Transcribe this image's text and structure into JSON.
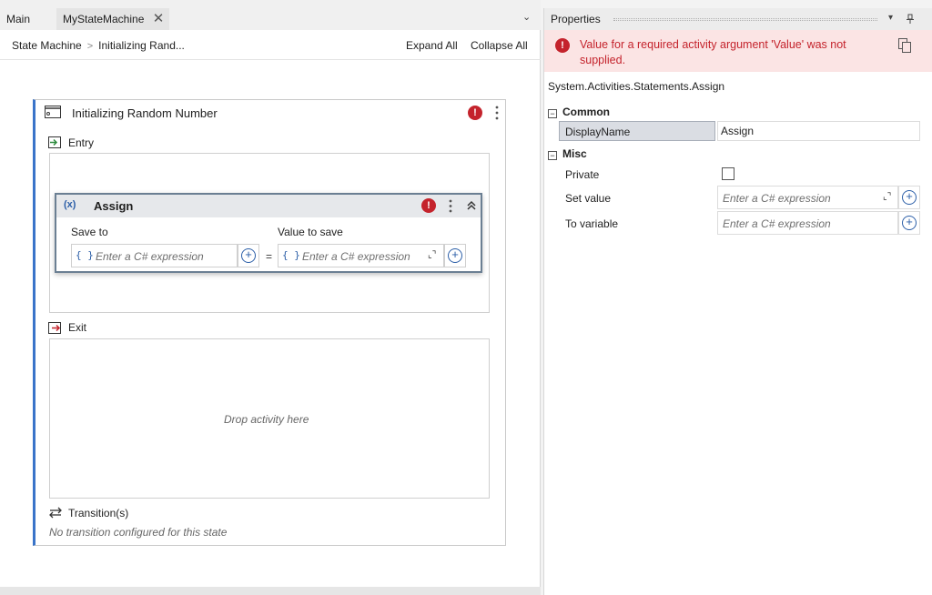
{
  "tabs": {
    "main": "Main",
    "active": "MyStateMachine",
    "close_glyph": "✕",
    "overflow_glyph": "⌄"
  },
  "breadcrumb": {
    "root": "State Machine",
    "separator": ">",
    "current": "Initializing Rand..."
  },
  "toolbar": {
    "expand_all": "Expand All",
    "collapse_all": "Collapse All"
  },
  "state": {
    "title": "Initializing Random Number",
    "entry_label": "Entry",
    "exit_label": "Exit",
    "exit_drop_text": "Drop activity here",
    "transitions_label": "Transition(s)",
    "no_transition_text": "No transition configured for this state",
    "error_glyph": "!"
  },
  "assign": {
    "icon_text": "(x)",
    "title": "Assign",
    "save_to_label": "Save to",
    "value_to_save_label": "Value to save",
    "save_to_placeholder": "Enter a C# expression",
    "value_placeholder": "Enter a C# expression",
    "brace_text": "{ }",
    "equals_text": "=",
    "plus_glyph": "+",
    "expand_glyph": "⌞⌝",
    "collapse_glyph": "⌃",
    "error_glyph": "!"
  },
  "properties": {
    "title": "Properties",
    "dropdown_glyph": "▾",
    "pin_glyph": "📌",
    "error_message": "Value for a required activity argument 'Value' was not supplied.",
    "error_glyph": "!",
    "type_name": "System.Activities.Statements.Assign",
    "categories": {
      "common": "Common",
      "misc": "Misc",
      "expand_glyph": "−"
    },
    "display_name_label": "DisplayName",
    "display_name_value": "Assign",
    "private_label": "Private",
    "private_checked": false,
    "set_value_label": "Set value",
    "set_value_placeholder": "Enter a C# expression",
    "to_variable_label": "To variable",
    "to_variable_placeholder": "Enter a C# expression",
    "plus_glyph": "+",
    "expand_glyph": "⌞⌝"
  },
  "colors": {
    "error_red": "#c4232c",
    "accent_blue": "#2c5fa8",
    "state_border": "#3a74c9",
    "error_banner_bg": "#fbe4e4"
  },
  "icons": {
    "state": "state-window-icon",
    "entry": "entry-arrow-icon",
    "exit": "exit-arrow-icon",
    "transitions": "swap-arrows-icon",
    "copy": "copy-icon"
  }
}
